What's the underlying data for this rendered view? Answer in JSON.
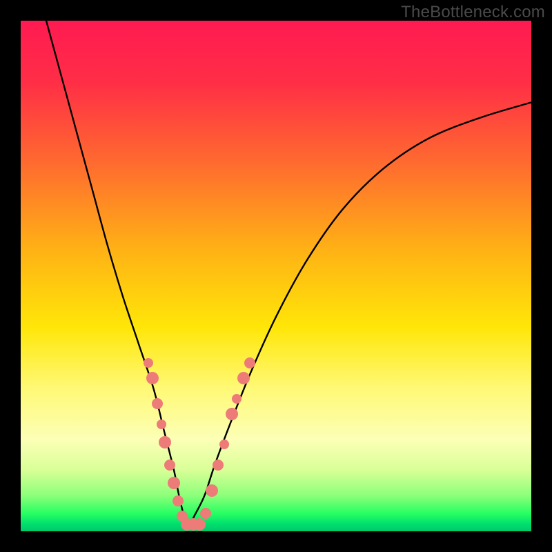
{
  "watermark": "TheBottleneck.com",
  "chart_data": {
    "type": "line",
    "title": "",
    "xlabel": "",
    "ylabel": "",
    "xlim": [
      0,
      100
    ],
    "ylim": [
      0,
      100
    ],
    "gradient_stops": [
      {
        "offset": 0.0,
        "color": "#ff1a52"
      },
      {
        "offset": 0.12,
        "color": "#ff2e46"
      },
      {
        "offset": 0.28,
        "color": "#ff6b2f"
      },
      {
        "offset": 0.45,
        "color": "#ffb215"
      },
      {
        "offset": 0.6,
        "color": "#ffe608"
      },
      {
        "offset": 0.72,
        "color": "#fff976"
      },
      {
        "offset": 0.82,
        "color": "#fcffb6"
      },
      {
        "offset": 0.88,
        "color": "#d9ff97"
      },
      {
        "offset": 0.93,
        "color": "#8cff7a"
      },
      {
        "offset": 0.965,
        "color": "#27ff62"
      },
      {
        "offset": 0.985,
        "color": "#00e06e"
      },
      {
        "offset": 1.0,
        "color": "#00c86a"
      }
    ],
    "series": [
      {
        "name": "bottleneck-curve",
        "x": [
          5,
          8,
          11,
          14,
          17,
          20,
          23,
          26,
          28,
          30,
          31,
          32,
          33,
          34,
          36,
          38,
          41,
          45,
          50,
          56,
          63,
          71,
          80,
          90,
          100
        ],
        "y": [
          100,
          89,
          78,
          67,
          56,
          46,
          37,
          28,
          20,
          12,
          7,
          3,
          1,
          3,
          7,
          13,
          21,
          31,
          42,
          53,
          63,
          71,
          77,
          81,
          84
        ]
      }
    ],
    "scatter": {
      "name": "highlight-points",
      "color": "#ed7b78",
      "points": [
        {
          "x": 25.0,
          "y": 33,
          "r": 7
        },
        {
          "x": 25.8,
          "y": 30,
          "r": 9
        },
        {
          "x": 26.8,
          "y": 25,
          "r": 8
        },
        {
          "x": 27.5,
          "y": 21,
          "r": 7
        },
        {
          "x": 28.3,
          "y": 17.5,
          "r": 9
        },
        {
          "x": 29.2,
          "y": 13,
          "r": 8
        },
        {
          "x": 30.0,
          "y": 9.5,
          "r": 9
        },
        {
          "x": 30.8,
          "y": 6,
          "r": 8
        },
        {
          "x": 31.6,
          "y": 3,
          "r": 8
        },
        {
          "x": 32.6,
          "y": 1.4,
          "r": 9
        },
        {
          "x": 33.8,
          "y": 1.4,
          "r": 9
        },
        {
          "x": 35.0,
          "y": 1.4,
          "r": 9
        },
        {
          "x": 36.2,
          "y": 3.5,
          "r": 8
        },
        {
          "x": 37.4,
          "y": 8,
          "r": 9
        },
        {
          "x": 38.6,
          "y": 13,
          "r": 8
        },
        {
          "x": 39.8,
          "y": 17,
          "r": 7
        },
        {
          "x": 41.4,
          "y": 23,
          "r": 9
        },
        {
          "x": 42.3,
          "y": 26,
          "r": 7
        },
        {
          "x": 43.6,
          "y": 30,
          "r": 9
        },
        {
          "x": 44.8,
          "y": 33,
          "r": 8
        }
      ]
    }
  }
}
